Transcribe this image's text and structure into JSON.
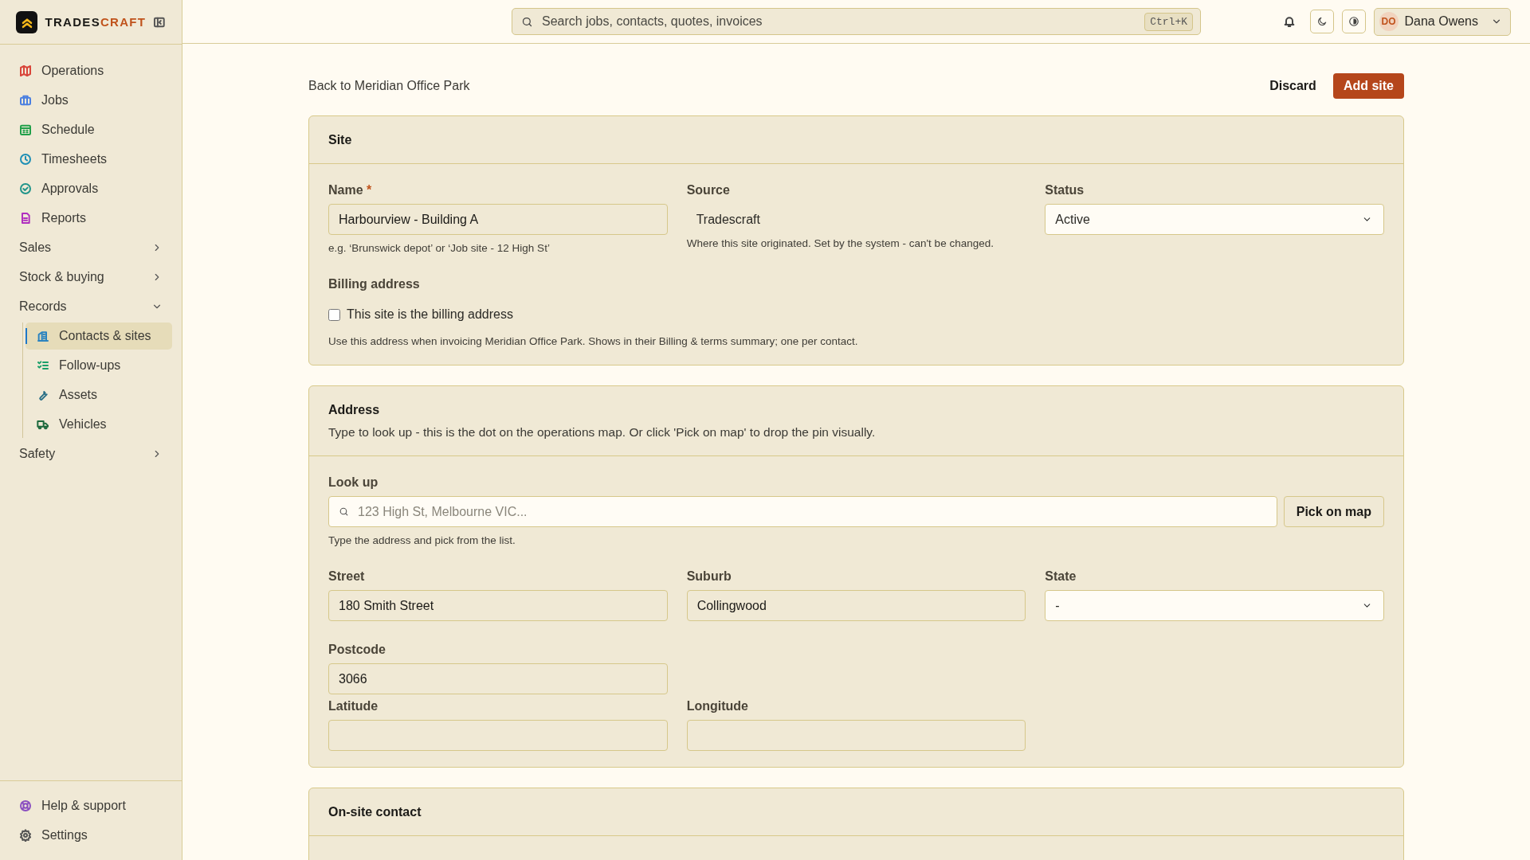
{
  "brand": {
    "mark": "TRADES",
    "accent": "CRAFT"
  },
  "sidebar": {
    "items": [
      {
        "kind": "link",
        "label": "Operations",
        "color": "#d9463b",
        "selected": false
      },
      {
        "kind": "link",
        "label": "Jobs",
        "color": "#4a7fe0",
        "selected": false
      },
      {
        "kind": "link",
        "label": "Schedule",
        "color": "#22a04a",
        "selected": false
      },
      {
        "kind": "link",
        "label": "Timesheets",
        "color": "#1e8fb5",
        "selected": false
      },
      {
        "kind": "link",
        "label": "Approvals",
        "color": "#21958a",
        "selected": false
      },
      {
        "kind": "link",
        "label": "Reports",
        "color": "#b02fbf",
        "selected": false
      },
      {
        "kind": "group",
        "label": "Sales",
        "expanded": false,
        "selected": false
      },
      {
        "kind": "group",
        "label": "Stock & buying",
        "expanded": false,
        "selected": false
      },
      {
        "kind": "group",
        "label": "Records",
        "expanded": true,
        "selected": false,
        "children": [
          {
            "label": "Contacts & sites",
            "color": "#2a83c0",
            "selected": true
          },
          {
            "label": "Follow-ups",
            "color": "#1a9f6a",
            "selected": false
          },
          {
            "label": "Assets",
            "color": "#2a6f86",
            "selected": false
          },
          {
            "label": "Vehicles",
            "color": "#1e6a3e",
            "selected": false
          }
        ]
      },
      {
        "kind": "group",
        "label": "Safety",
        "expanded": false,
        "selected": false
      }
    ],
    "footer": [
      {
        "label": "Help & support",
        "color": "#8a4fc0"
      },
      {
        "label": "Settings",
        "color": "#555555"
      }
    ]
  },
  "topbar": {
    "search_placeholder": "Search jobs, contacts, quotes, invoices",
    "shortcut": "Ctrl+K",
    "user": {
      "initials": "DO",
      "name": "Dana Owens"
    }
  },
  "page": {
    "back_link": "Back to Meridian Office Park",
    "actions": [
      {
        "kind": "secondary",
        "label": "Discard"
      },
      {
        "kind": "primary",
        "label": "Add site"
      }
    ]
  },
  "cards": [
    {
      "title": "Site",
      "rows": [
        [
          {
            "kind": "text",
            "label": "Name",
            "required_mark": "*",
            "value": "Harbourview - Building A",
            "hint": "e.g. ‘Brunswick depot’ or ‘Job site - 12 High St’"
          },
          {
            "kind": "static",
            "label": "Source",
            "value": "Tradescraft",
            "hint": "Where this site originated. Set by the system - can't be changed."
          },
          {
            "kind": "select",
            "label": "Status",
            "value": "Active"
          }
        ],
        [
          {
            "kind": "checkbox",
            "label": "Billing address",
            "option": "This site is the billing address",
            "checked": false,
            "hint": "Use this address when invoicing Meridian Office Park. Shows in their Billing & terms summary; one per contact."
          }
        ]
      ]
    },
    {
      "title": "Address",
      "subtitle": "Type to look up - this is the dot on the operations map. Or click 'Pick on map' to drop the pin visually.",
      "rows": [
        [
          {
            "kind": "lookup",
            "label": "Look up",
            "placeholder": "123 High St, Melbourne VIC...",
            "button": "Pick on map",
            "hint": "Type the address and pick from the list."
          }
        ],
        [
          {
            "kind": "text",
            "label": "Street",
            "value": "180 Smith Street"
          },
          {
            "kind": "text",
            "label": "Suburb",
            "value": "Collingwood"
          },
          {
            "kind": "select",
            "label": "State",
            "value": "-"
          }
        ],
        [
          {
            "kind": "text",
            "label": "Postcode",
            "value": "3066"
          }
        ],
        [
          {
            "kind": "text",
            "label": "Latitude"
          },
          {
            "kind": "text",
            "label": "Longitude"
          }
        ]
      ]
    },
    {
      "title": "On-site contact"
    }
  ]
}
